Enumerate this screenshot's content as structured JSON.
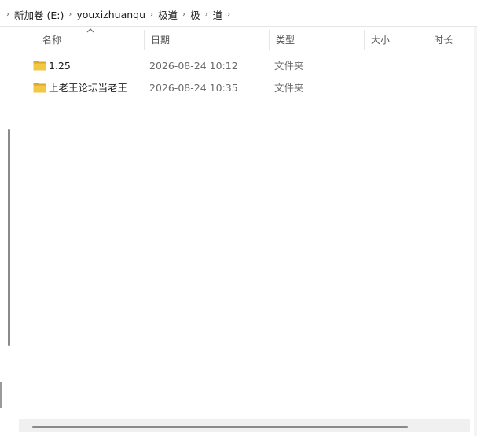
{
  "breadcrumb": {
    "items": [
      "新加卷 (E:)",
      "youxizhuanqu",
      "极道",
      "极",
      "道"
    ]
  },
  "columns": {
    "name": "名称",
    "date": "日期",
    "type": "类型",
    "size": "大小",
    "duration": "时长"
  },
  "rows": [
    {
      "name": "1.25",
      "date": "2026-08-24 10:12",
      "type": "文件夹"
    },
    {
      "name": "上老王论坛当老王",
      "date": "2026-08-24 10:35",
      "type": "文件夹"
    }
  ],
  "colors": {
    "folder": "#f2c744",
    "folder_dark": "#dca92a",
    "scrollbar": "#8a8a8a"
  }
}
